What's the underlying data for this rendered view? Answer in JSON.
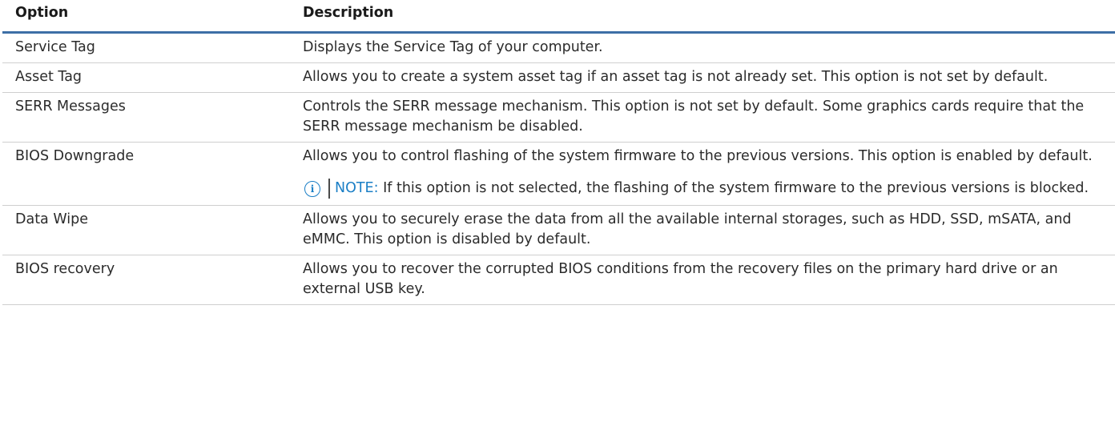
{
  "table": {
    "headers": {
      "option": "Option",
      "description": "Description"
    },
    "rows": [
      {
        "option": "Service Tag",
        "description": "Displays the Service Tag of your computer."
      },
      {
        "option": "Asset Tag",
        "description": "Allows you to create a system asset tag if an asset tag is not already set. This option is not set by default."
      },
      {
        "option": "SERR Messages",
        "description": "Controls the SERR message mechanism. This option is not set by default. Some graphics cards require that the SERR message mechanism be disabled."
      },
      {
        "option": "BIOS Downgrade",
        "description": "Allows you to control flashing of the system firmware to the previous versions. This option is enabled by default.",
        "note_label": "NOTE:",
        "note_text": " If this option is not selected, the flashing of the system firmware to the previous versions is blocked.",
        "note_icon": "info-circle-icon"
      },
      {
        "option": "Data Wipe",
        "description": "Allows you to securely erase the data from all the available internal storages, such as HDD, SSD, mSATA, and eMMC. This option is disabled by default."
      },
      {
        "option": "BIOS recovery",
        "description": "Allows you to recover the corrupted BIOS conditions from the recovery files on the primary hard drive or an external USB key."
      }
    ]
  },
  "colors": {
    "header_rule": "#3d6fa6",
    "note_accent": "#1b7fc6",
    "row_divider": "#cfcfcf"
  }
}
